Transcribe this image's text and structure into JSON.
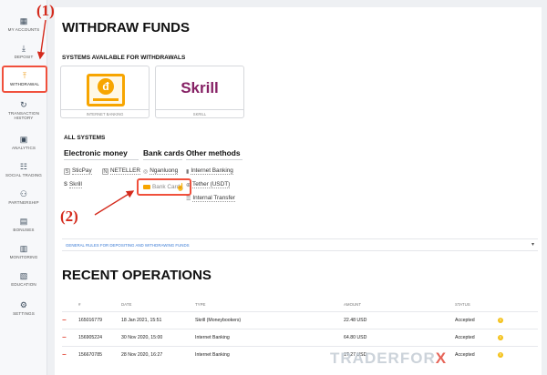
{
  "sidebar": {
    "items": [
      {
        "label": "MY ACCOUNTS",
        "icon": "grid-icon"
      },
      {
        "label": "DEPOSIT",
        "icon": "download-icon"
      },
      {
        "label": "WITHDRAWAL",
        "icon": "upload-icon",
        "active": true
      },
      {
        "label": "TRANSACTION HISTORY",
        "icon": "history-icon"
      },
      {
        "label": "ANALYTICS",
        "icon": "chart-icon"
      },
      {
        "label": "SOCIAL TRADING",
        "icon": "people-icon"
      },
      {
        "label": "PARTNERSHIP",
        "icon": "network-icon"
      },
      {
        "label": "BONUSES",
        "icon": "gift-icon"
      },
      {
        "label": "MONITORING",
        "icon": "monitor-icon"
      },
      {
        "label": "EDUCATION",
        "icon": "book-icon"
      },
      {
        "label": "SETTINGS",
        "icon": "gear-icon"
      }
    ]
  },
  "page": {
    "title": "WITHDRAW FUNDS",
    "systems_available": "SYSTEMS AVAILABLE FOR WITHDRAWALS",
    "cards": [
      {
        "name": "INTERNET BANKING",
        "logo": "đ"
      },
      {
        "name": "SKRILL",
        "logo": "Skrill"
      }
    ],
    "all_systems": "ALL SYSTEMS",
    "categories": {
      "electronic": "Electronic money",
      "bank": "Bank cards",
      "other": "Other methods"
    },
    "methods": {
      "sticpay": "SticPay",
      "neteller": "NETELLER",
      "skrill": "Skrill",
      "ngan_luong": "Nganluong",
      "bank_card": "Bank Card",
      "internet_banking": "Internet Banking",
      "tether": "Tether (USDT)",
      "internal_transfer": "Internal Transfer"
    },
    "rules_link": "GENERAL RULES FOR DEPOSITING AND WITHDRAWING FUNDS",
    "recent_title": "RECENT OPERATIONS"
  },
  "table": {
    "headers": [
      "#",
      "DATE",
      "TYPE",
      "AMOUNT",
      "STATUS"
    ],
    "rows": [
      {
        "id": "165016779",
        "date": "18 Jan 2021, 15:51",
        "type": "Skrill (Moneybookers)",
        "amount": "22.48 USD",
        "status": "Accepted"
      },
      {
        "id": "156905224",
        "date": "30 Nov 2020, 15:00",
        "type": "Internet Banking",
        "amount": "64.80 USD",
        "status": "Accepted"
      },
      {
        "id": "156670785",
        "date": "28 Nov 2020, 16:27",
        "type": "Internet Banking",
        "amount": "17.27 USD",
        "status": "Accepted"
      }
    ]
  },
  "annotations": {
    "one": "(1)",
    "two": "(2)"
  },
  "watermark": {
    "part1": "TRADERFOR",
    "part2": "X"
  },
  "colors": {
    "accent": "#f0503c",
    "annotation": "#d42a1c",
    "skrill": "#862165",
    "bank_card_bg": "#f7a500",
    "warning": "#f4c21b"
  }
}
